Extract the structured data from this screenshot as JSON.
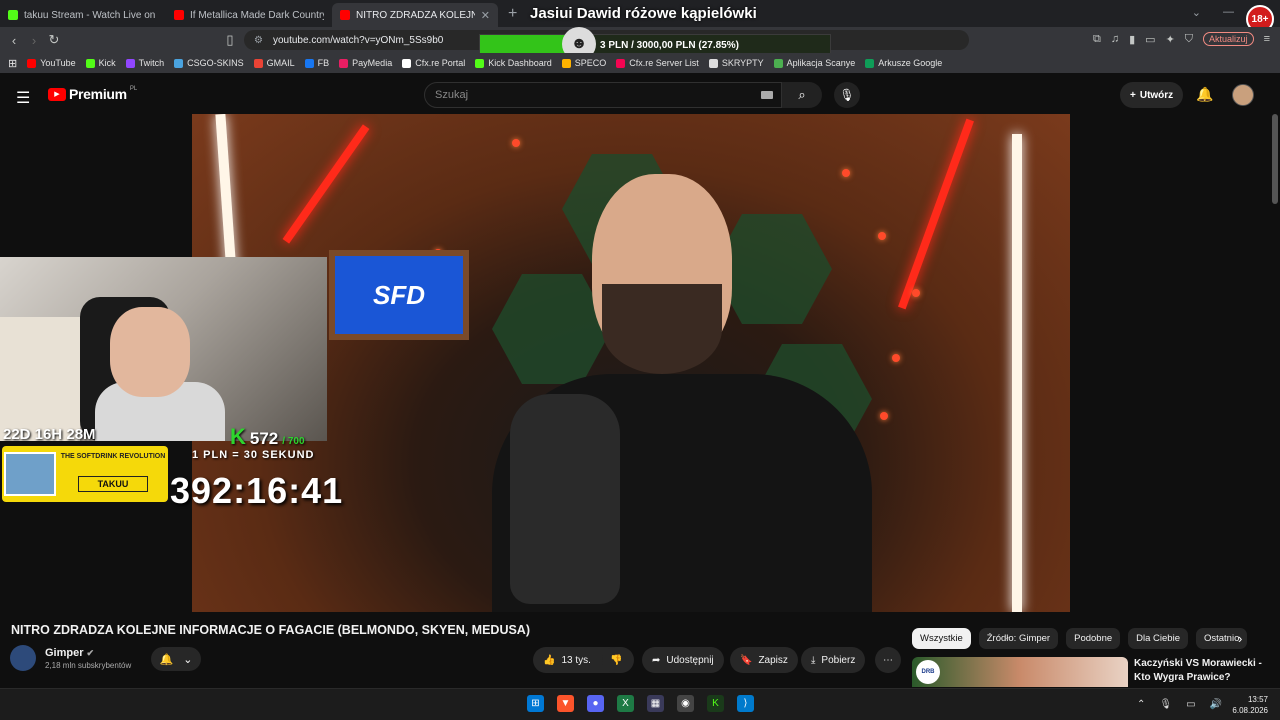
{
  "browser": {
    "tabs": [
      {
        "title": "takuu Stream - Watch Live on Ki",
        "color": "#53fc18",
        "active": false
      },
      {
        "title": "If Metallica Made Dark Country (Seei",
        "color": "#ff0000",
        "active": false
      },
      {
        "title": "NITRO ZDRADZA KOLEJNE IN",
        "color": "#ff0000",
        "active": true
      }
    ],
    "new_tab": "+",
    "overlay_title": "Jasiui Dawid różowe kąpielówki",
    "age_badge": "18+",
    "url": "youtube.com/watch?v=yONm_5Ss9b0",
    "update_button": "Aktualizuj",
    "bookmarks": [
      {
        "label": "YouTube",
        "color": "#ff0000"
      },
      {
        "label": "Kick",
        "color": "#53fc18"
      },
      {
        "label": "Twitch",
        "color": "#9146ff"
      },
      {
        "label": "CSGO-SKINS",
        "color": "#4aa3df"
      },
      {
        "label": "GMAIL",
        "color": "#ea4335"
      },
      {
        "label": "FB",
        "color": "#1877f2"
      },
      {
        "label": "PayMedia",
        "color": "#e91e63"
      },
      {
        "label": "Cfx.re Portal",
        "color": "#ffffff"
      },
      {
        "label": "Kick Dashboard",
        "color": "#53fc18"
      },
      {
        "label": "SPECO",
        "color": "#ffb300"
      },
      {
        "label": "Cfx.re Server List",
        "color": "#f40552"
      },
      {
        "label": "SKRYPTY",
        "color": "#dddddd"
      },
      {
        "label": "Aplikacja Scanye",
        "color": "#4caf50"
      },
      {
        "label": "Arkusze Google",
        "color": "#0f9d58"
      }
    ]
  },
  "donation_goal": {
    "text": "3 PLN / 3000,00 PLN  (27.85%)",
    "progress": 0.2785
  },
  "youtube": {
    "logo_text": "Premium",
    "logo_region": "PL",
    "search_placeholder": "Szukaj",
    "create_label": "Utwórz",
    "video_title": "NITRO ZDRADZA KOLEJNE INFORMACJE O FAGACIE (BELMONDO, SKYEN, MEDUSA)",
    "channel_name": "Gimper",
    "subscribers": "2,18 mln subskrybentów",
    "likes": "13 tys.",
    "share_label": "Udostępnij",
    "save_label": "Zapisz",
    "download_label": "Pobierz",
    "more_label": "⋯",
    "chips": [
      "Wszystkie",
      "Źródło: Gimper",
      "Podobne",
      "Dla Ciebie",
      "Ostatnio"
    ],
    "recommended": {
      "title": "Kaczyński VS Morawiecki - Kto Wygra Prawice?",
      "badge": "DRB"
    }
  },
  "stream_overlay": {
    "video_logo": "SFD",
    "subathon_timer": "22D 16H 28M",
    "counter": "572",
    "counter_max": "/ 700",
    "rate": "1 PLN = 30 SEKUND",
    "big_timer": "392:16:41",
    "promo_heading": "THE SOFTDRINK REVOLUTION",
    "promo_code": "TAKUU"
  },
  "taskbar": {
    "time": "13:57",
    "date": "6.08.2026"
  },
  "icons": {
    "back": "back-icon",
    "forward": "forward-icon",
    "reload": "reload-icon",
    "menu": "hamburger-icon",
    "search": "search-icon",
    "mic": "microphone-icon",
    "bell": "bell-icon"
  }
}
